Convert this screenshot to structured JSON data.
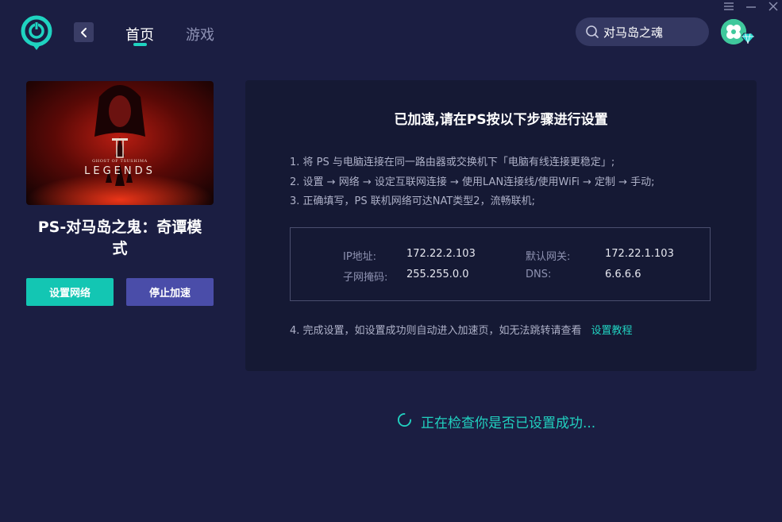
{
  "header": {
    "tabs": [
      {
        "label": "首页",
        "active": true
      },
      {
        "label": "游戏",
        "active": false
      }
    ],
    "search": {
      "value": "对马岛之魂"
    }
  },
  "game": {
    "cover_logo_small": "GHOST OF TSUSHIMA",
    "cover_logo_large": "LEGENDS",
    "title_line1": "PS-对马岛之鬼：奇谭模",
    "title_line2": "式",
    "setup_button": "设置网络",
    "stop_button": "停止加速"
  },
  "panel": {
    "title": "已加速,请在PS按以下步骤进行设置",
    "steps": [
      "1. 将 PS 与电脑连接在同一路由器或交换机下「电脑有线连接更稳定」;",
      "2. 设置 → 网络 → 设定互联网连接 → 使用LAN连接线/使用WiFi → 定制 → 手动;",
      "3. 正确填写，PS 联机网络可达NAT类型2，流畅联机;"
    ],
    "network": {
      "ip_label": "IP地址:",
      "ip_value": "172.22.2.103",
      "gateway_label": "默认网关:",
      "gateway_value": "172.22.1.103",
      "mask_label": "子网掩码:",
      "mask_value": "255.255.0.0",
      "dns_label": "DNS:",
      "dns_value": "6.6.6.6"
    },
    "step4_text": "4. 完成设置，如设置成功则自动进入加速页，如无法跳转请查看",
    "step4_link": "设置教程"
  },
  "status": {
    "text": "正在检查你是否已设置成功..."
  },
  "colors": {
    "background": "#1b1e42",
    "panel": "#151934",
    "accent": "#1fd3c1",
    "stop_button": "#4a4da9",
    "search_bg": "#343862"
  },
  "icons": [
    "app-logo-icon",
    "back-arrow-icon",
    "search-icon",
    "vip-diamond-icon",
    "menu-icon",
    "minimize-icon",
    "close-icon",
    "loading-spinner-icon"
  ]
}
